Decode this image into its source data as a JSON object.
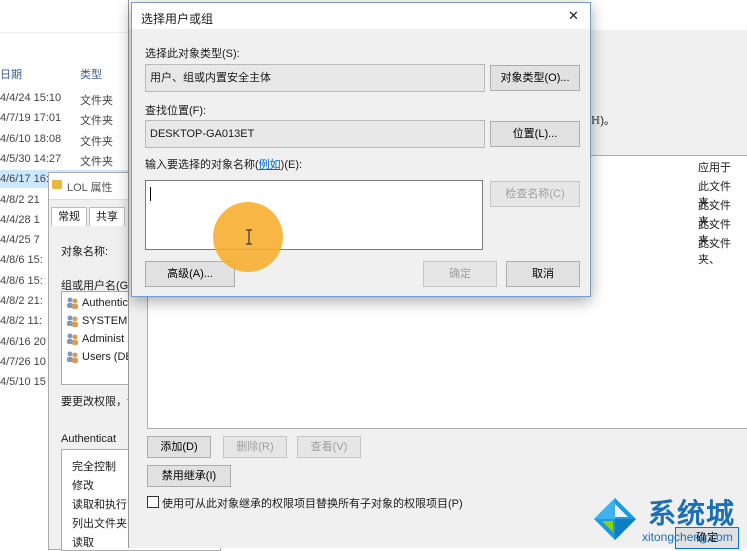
{
  "explorer": {
    "col_date": "日期",
    "col_type": "类型",
    "rows": [
      {
        "date": "4/4/24 15:10",
        "type": "文件夹"
      },
      {
        "date": "4/7/19 17:01",
        "type": "文件夹"
      },
      {
        "date": "4/6/10 18:08",
        "type": "文件夹"
      },
      {
        "date": "4/5/30 14:27",
        "type": "文件夹"
      },
      {
        "date": "4/6/17 16:09",
        "type": "文件夹"
      },
      {
        "date": "4/8/2 21",
        "type": ""
      },
      {
        "date": "4/4/28 1",
        "type": ""
      },
      {
        "date": "4/4/25 7",
        "type": ""
      },
      {
        "date": "4/8/6 15:",
        "type": ""
      },
      {
        "date": "4/8/6 15:",
        "type": ""
      },
      {
        "date": "4/8/2 21:",
        "type": ""
      },
      {
        "date": "4/8/2 11:",
        "type": ""
      },
      {
        "date": "4/6/16 20",
        "type": ""
      },
      {
        "date": "4/7/26 10",
        "type": ""
      },
      {
        "date": "4/5/10 15",
        "type": ""
      }
    ]
  },
  "props": {
    "title": "LOL 属性",
    "tabs": [
      "常规",
      "共享"
    ],
    "object_name_label": "对象名称:",
    "group_label": "组或用户名(G):",
    "users": [
      "Authentic",
      "SYSTEM",
      "Administ",
      "Users (DE"
    ],
    "change_perm_text": "要更改权限，请",
    "perm_for_label": "Authenticat",
    "perms": [
      "完全控制",
      "修改",
      "读取和执行",
      "列出文件夹",
      "读取"
    ]
  },
  "adv": {
    "apply_header": "应用于",
    "apply_rows": [
      "此文件夹、",
      "此文件夹、",
      "此文件夹、",
      "此文件夹、"
    ],
    "note_fragment": "ℍ)。",
    "add_button": "添加(D)",
    "remove_button": "删除(R)",
    "view_button": "查看(V)",
    "disable_inherit_button": "禁用继承(I)",
    "replace_checkbox_label": "使用可从此对象继承的权限项目替换所有子对象的权限项目(P)",
    "confirm_button": "确定"
  },
  "dialog": {
    "title": "选择用户或组",
    "close_glyph": "✕",
    "object_type_label": "选择此对象类型(S):",
    "object_type_value": "用户、组或内置安全主体",
    "object_type_button": "对象类型(O)...",
    "location_label": "查找位置(F):",
    "location_value": "DESKTOP-GA013ET",
    "location_button": "位置(L)...",
    "enter_names_label_pre": "输入要选择的对象名称(",
    "enter_names_label_link": "例如",
    "enter_names_label_post": ")(E):",
    "names_value": "",
    "check_names_button": "检查名称(C)",
    "advanced_button": "高级(A)...",
    "ok_button": "确定",
    "cancel_button": "取消"
  },
  "watermark": {
    "brand": "系统城",
    "url": "xitongcheng.com"
  },
  "colors": {
    "accent_blue": "#0078d7",
    "cursor_highlight": "#f7ad2a",
    "dialog_border": "#7a9cc9"
  }
}
